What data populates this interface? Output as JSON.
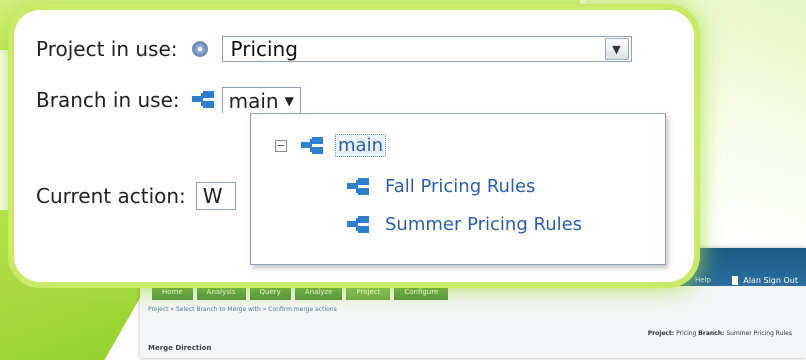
{
  "form": {
    "project_label": "Project in use:",
    "project_value": "Pricing",
    "branch_label": "Branch in use:",
    "branch_value": "main",
    "action_label": "Current action:",
    "action_value": "W"
  },
  "branch_tree": {
    "root": "main",
    "children": [
      "Fall Pricing Rules",
      "Summer Pricing Rules"
    ]
  },
  "icons": {
    "project": "gear-icon",
    "branch": "branch-icon",
    "dropdown": "chevron-down-icon",
    "collapse": "collapse-minus-icon"
  },
  "background_app": {
    "tabs": [
      "Home",
      "Analysis",
      "Query",
      "Analyze",
      "Project",
      "Configure"
    ],
    "user": "Alan",
    "sign_out": "Sign Out",
    "help": "Help",
    "breadcrumb": "Project » Select Branch to Merge with » Confirm merge actions",
    "project_label": "Project:",
    "project_value": "Pricing",
    "branch_label": "Branch:",
    "branch_value": "Summer Pricing Rules",
    "merge_heading": "Merge Direction"
  },
  "colors": {
    "accent_green": "#c8ea66",
    "link_blue": "#2a5fa8",
    "header_blue": "#1e5a83"
  }
}
